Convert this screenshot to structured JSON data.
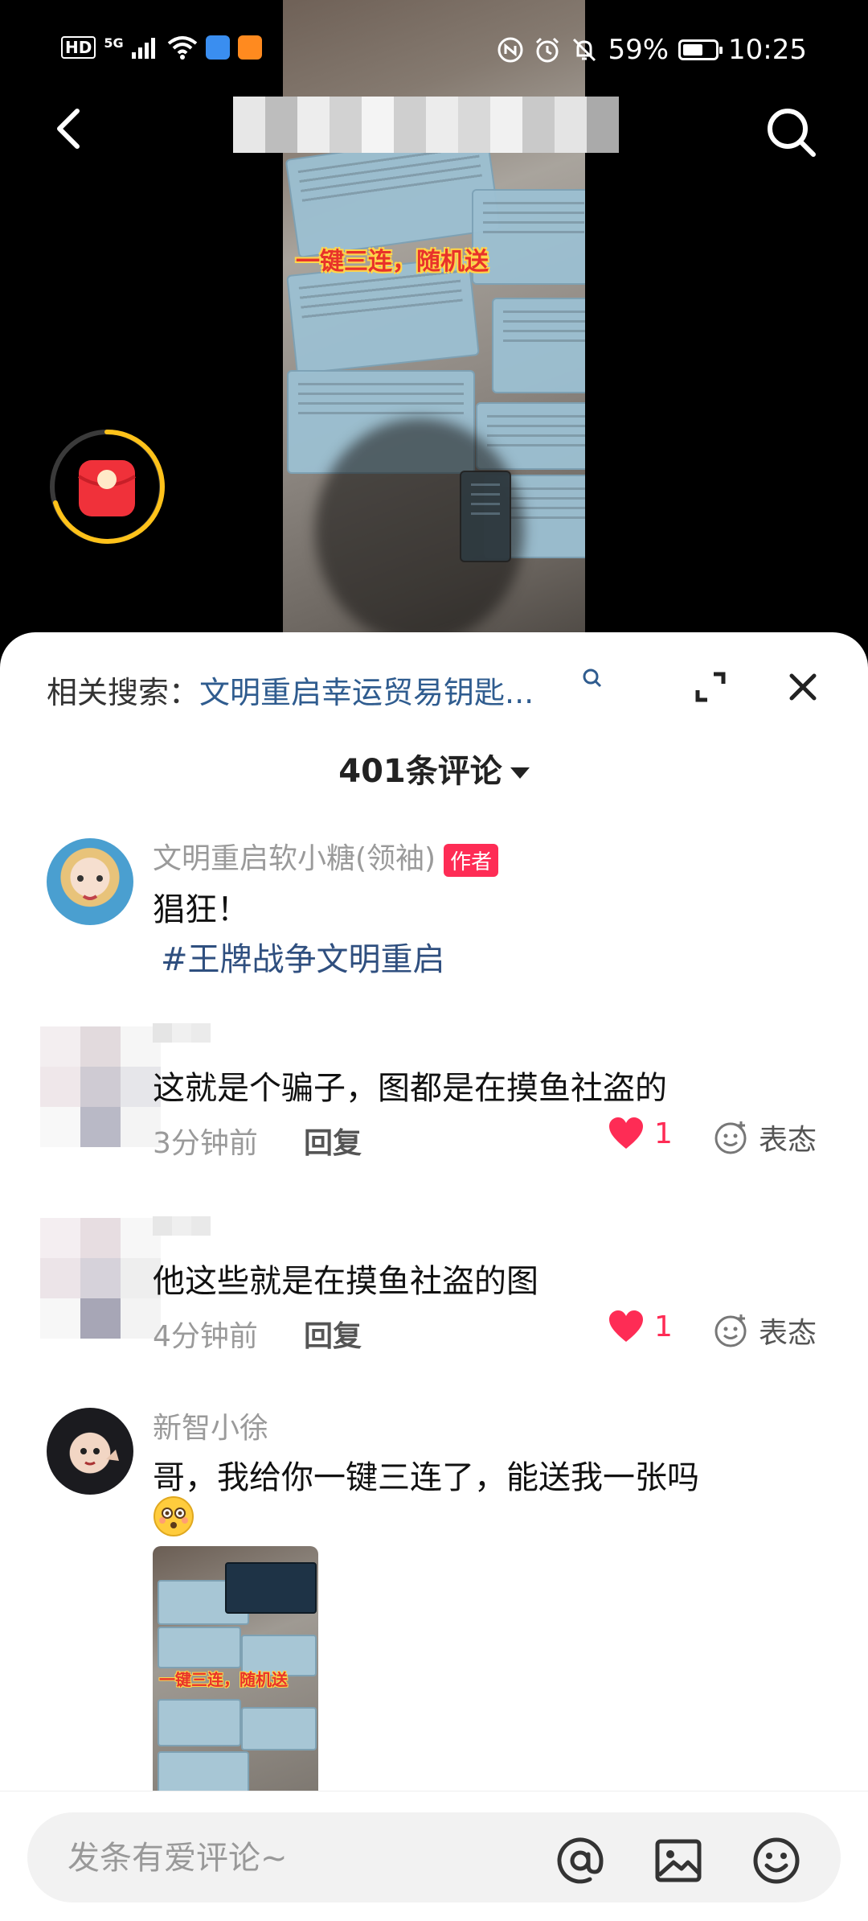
{
  "status_bar": {
    "left_labels": [
      "HD",
      "5G"
    ],
    "battery": "59%",
    "battery_level": 0.59,
    "time": "10:25"
  },
  "video": {
    "caption": "一键三连，随机送",
    "icons": [
      "back-icon",
      "search-icon",
      "red-packet-icon"
    ]
  },
  "panel": {
    "related_label": "相关搜索：",
    "related_query": "文明重启幸运贸易钥匙...",
    "comment_count": "401条评论"
  },
  "comments": [
    {
      "username": "文明重启软小糖(领袖)",
      "author_badge": "作者",
      "text": "猖狂！",
      "hashtag": "#王牌战争文明重启"
    },
    {
      "text": "这就是个骗子，图都是在摸鱼社盗的",
      "time": "3分钟前",
      "reply": "回复",
      "likes": "1",
      "react": "表态"
    },
    {
      "text": "他这些就是在摸鱼社盗的图",
      "time": "4分钟前",
      "reply": "回复",
      "likes": "1",
      "react": "表态"
    },
    {
      "username": "新智小徐",
      "text": "哥，我给你一键三连了，能送我一张吗",
      "emoji": "flushed-face",
      "image_caption": "一键三连，随机送"
    }
  ],
  "input": {
    "placeholder": "发条有爱评论~"
  },
  "colors": {
    "accent_red": "#fe2c55",
    "hashtag_blue": "#2f4f7f",
    "query_blue": "#2f5c8f"
  }
}
